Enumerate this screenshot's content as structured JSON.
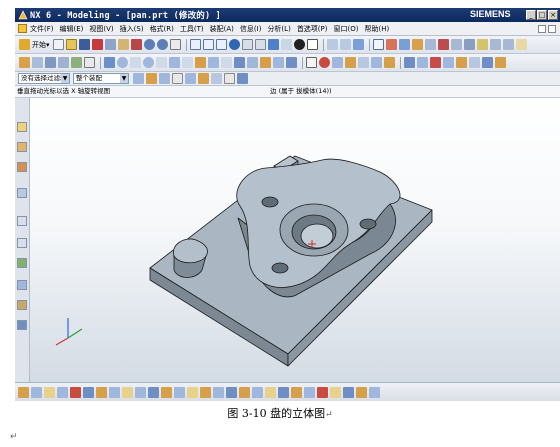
{
  "window": {
    "title": "NX 6 - Modeling - [pan.prt (修改的) ]",
    "brand": "SIEMENS"
  },
  "menu": {
    "items": [
      "文件(F)",
      "编辑(E)",
      "视图(V)",
      "插入(S)",
      "格式(R)",
      "工具(T)",
      "装配(A)",
      "信息(I)",
      "分析(L)",
      "首选项(P)",
      "窗口(O)",
      "帮助(H)"
    ]
  },
  "toolbar": {
    "start_label": "开始▾"
  },
  "selection": {
    "filter_value": "没有选择过滤器",
    "assembly_value": "整个装配"
  },
  "cue": {
    "left_text": "垂直拖动光标以选 X 轴旋转视图",
    "status_text": "边 (属于 拔模体(14))"
  },
  "caption": {
    "text": "图 3-10  盘的立体图",
    "mark": "↵",
    "para_mark": "↵"
  },
  "colors": {
    "title_bar": "#1e3c74",
    "part_face": "#a5b3bf",
    "part_edge": "#1a1a1a",
    "background_bottom": "#d3dbe4"
  },
  "icons": {
    "toolbar": [
      "open-icon",
      "save-icon",
      "cut-icon",
      "copy-icon",
      "paste-icon",
      "undo-icon",
      "redo-icon",
      "select-icon",
      "fit-icon",
      "zoom-icon",
      "rotate-icon",
      "pan-icon",
      "shaded-icon",
      "wireframe-icon",
      "layer-icon",
      "sketch-icon",
      "extrude-icon",
      "hole-icon",
      "boss-icon",
      "blend-icon",
      "chamfer-icon",
      "measure-icon"
    ]
  }
}
